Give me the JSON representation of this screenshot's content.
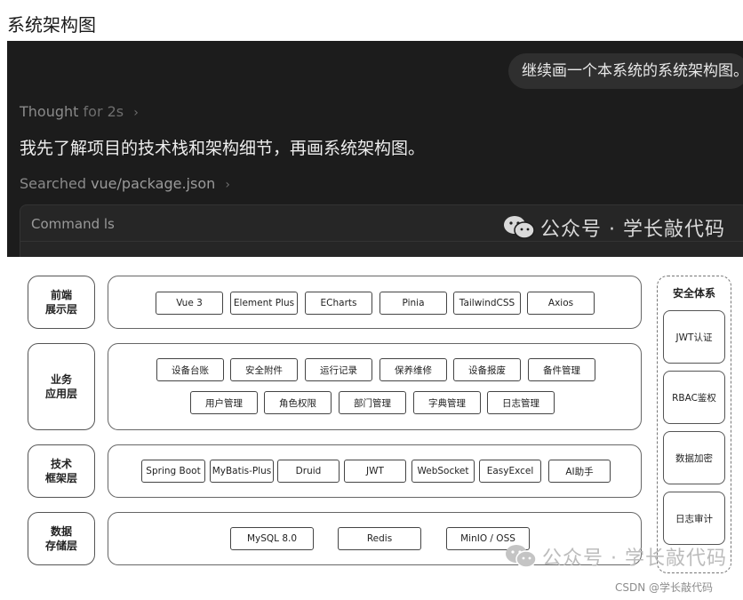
{
  "page": {
    "heading": "系统架构图"
  },
  "chat": {
    "user_message": "继续画一个本系统的系统架构图。",
    "thought_label": "Thought",
    "thought_duration": "for 2s",
    "assistant_message": "我先了解项目的技术栈和架构细节，再画系统架构图。",
    "searched_label": "Searched",
    "searched_path": "vue/package.json",
    "command_label": "Command ls"
  },
  "watermarks": {
    "top": "公众号 · 学长敲代码",
    "bottom": "公众号 · 学长敲代码",
    "csdn": "CSDN @学长敲代码"
  },
  "icons": {
    "wechat": "wechat-icon",
    "chevron": "chevron-right-icon"
  },
  "diagram": {
    "layers": [
      {
        "label": "前端\n展示层",
        "chips": [
          "Vue 3",
          "Element Plus",
          "ECharts",
          "Pinia",
          "TailwindCSS",
          "Axios"
        ]
      },
      {
        "label": "业务\n应用层",
        "chips": [
          "设备台账",
          "安全附件",
          "运行记录",
          "保养维修",
          "设备报废",
          "备件管理",
          "用户管理",
          "角色权限",
          "部门管理",
          "字典管理",
          "日志管理"
        ]
      },
      {
        "label": "技术\n框架层",
        "chips": [
          "Spring Boot",
          "MyBatis-Plus",
          "Druid",
          "JWT",
          "WebSocket",
          "EasyExcel",
          "AI助手"
        ]
      },
      {
        "label": "数据\n存储层",
        "chips": [
          "MySQL 8.0",
          "Redis",
          "MinIO / OSS"
        ]
      }
    ],
    "security": {
      "title": "安全体系",
      "items": [
        "JWT认证",
        "RBAC鉴权",
        "数据加密",
        "日志审计"
      ]
    }
  }
}
